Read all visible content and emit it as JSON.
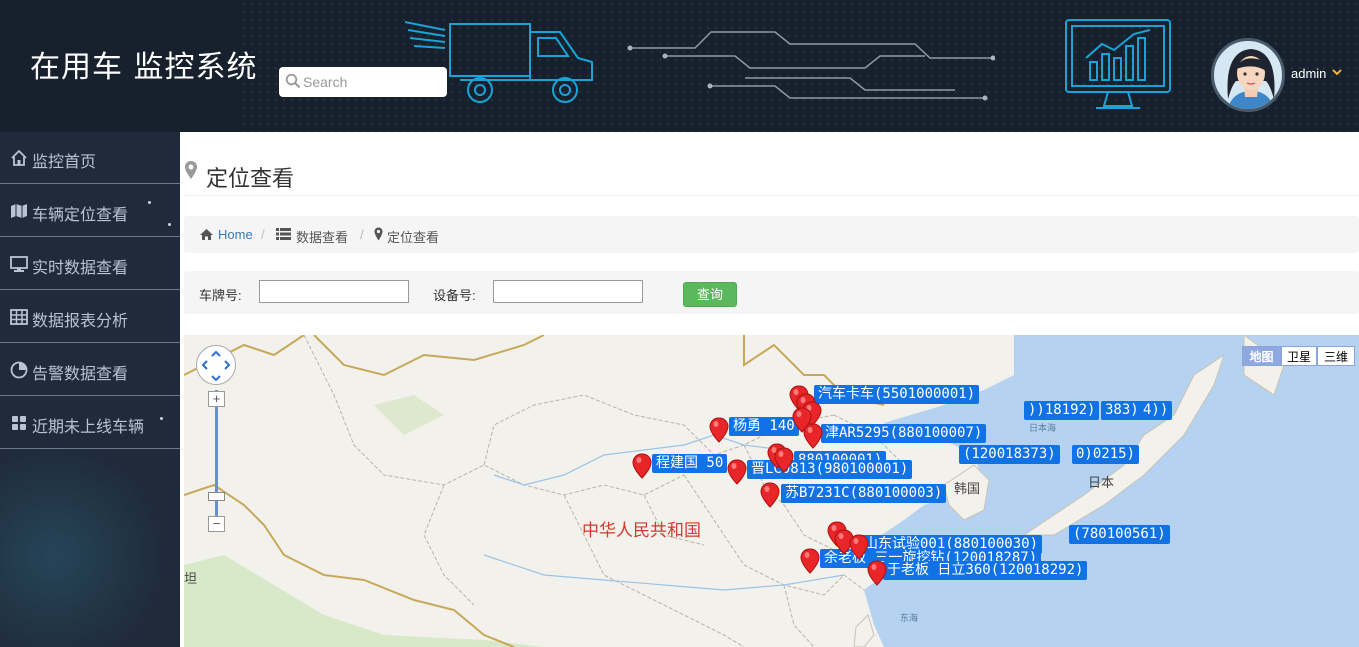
{
  "header": {
    "app_title": "在用车 监控系统",
    "search_placeholder": "Search",
    "user_name": "admin"
  },
  "sidebar": {
    "items": [
      {
        "label": "监控首页",
        "icon": "home-icon"
      },
      {
        "label": "车辆定位查看",
        "icon": "map-icon"
      },
      {
        "label": "实时数据查看",
        "icon": "desktop-icon"
      },
      {
        "label": "数据报表分析",
        "icon": "table-icon"
      },
      {
        "label": "告警数据查看",
        "icon": "pie-chart-icon"
      },
      {
        "label": "近期未上线车辆",
        "icon": "grid-icon"
      }
    ]
  },
  "page": {
    "title": "定位查看",
    "breadcrumb": {
      "home": "Home",
      "data": "数据查看",
      "current": "定位查看",
      "separator": "/"
    }
  },
  "filter": {
    "plate_label": "车牌号:",
    "plate_value": "",
    "device_label": "设备号:",
    "device_value": "",
    "query_label": "查询"
  },
  "map": {
    "types": {
      "map": "地图",
      "satellite": "卫星",
      "three_d": "三维"
    },
    "country_label": "中华人民共和国",
    "place_labels": {
      "korea": "韩国",
      "japan": "日本",
      "japan_sea": "日本海",
      "east_sea": "东海",
      "tan": "坦"
    },
    "vehicle_labels": [
      "杨勇 140",
      "津AR5295(880100007)",
      "程建国 50",
      "晋LC0813(980100001)",
      "苏B7231C(880100003)",
      "山东试验001(880100030)",
      "(780100561)",
      "余老板 三一旋挖钻(120018287)",
      "于老板 日立360(120018292)",
      "(120018373)",
      "0)0215)",
      "))18192)",
      "383)",
      "4))",
      "汽车卡车(5501000001)",
      "880100001)"
    ]
  }
}
